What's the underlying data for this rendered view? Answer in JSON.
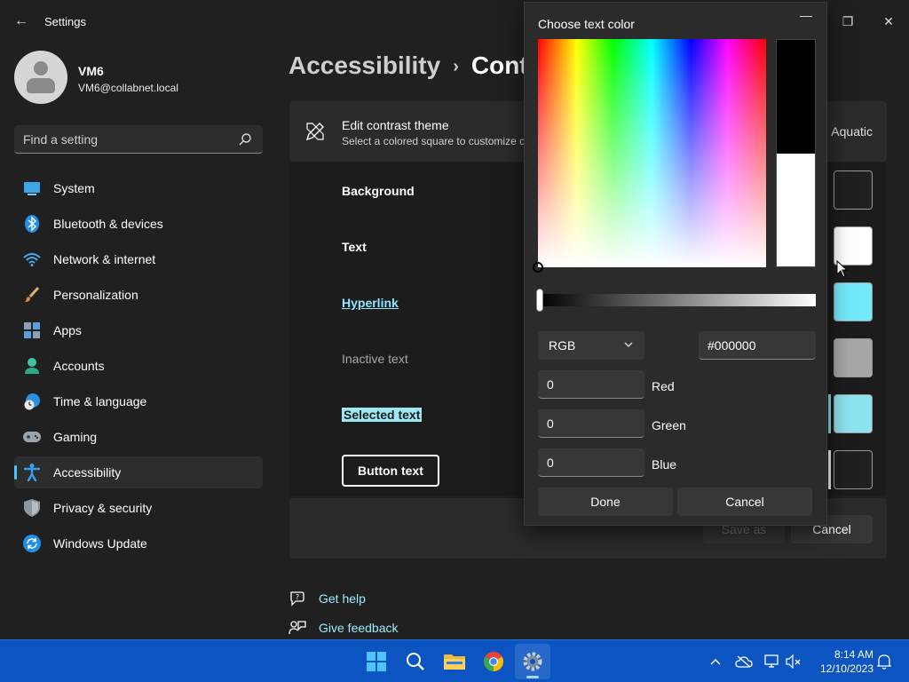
{
  "window": {
    "title": "Settings",
    "minimize_glyph": "—",
    "maximize_glyph": "❐",
    "close_glyph": "✕",
    "back_glyph": "←"
  },
  "profile": {
    "name": "VM6",
    "email": "VM6@collabnet.local"
  },
  "search": {
    "placeholder": "Find a setting"
  },
  "sidebar": {
    "items": [
      {
        "label": "System",
        "icon": "system-icon"
      },
      {
        "label": "Bluetooth & devices",
        "icon": "bluetooth-icon"
      },
      {
        "label": "Network & internet",
        "icon": "network-icon"
      },
      {
        "label": "Personalization",
        "icon": "brush-icon"
      },
      {
        "label": "Apps",
        "icon": "apps-icon"
      },
      {
        "label": "Accounts",
        "icon": "accounts-icon"
      },
      {
        "label": "Time & language",
        "icon": "clock-globe-icon"
      },
      {
        "label": "Gaming",
        "icon": "gamepad-icon"
      },
      {
        "label": "Accessibility",
        "icon": "accessibility-icon",
        "active": true
      },
      {
        "label": "Privacy & security",
        "icon": "shield-icon"
      },
      {
        "label": "Windows Update",
        "icon": "update-icon"
      }
    ]
  },
  "breadcrumb": {
    "parent": "Accessibility",
    "separator": "›",
    "current": "Contr"
  },
  "theme_card": {
    "title": "Edit contrast theme",
    "subtitle": "Select a colored square to customize c",
    "theme_name": "Aquatic"
  },
  "color_rows": [
    {
      "label": "Background",
      "swatch": "#202020"
    },
    {
      "label": "Text",
      "swatch": "#ffffff"
    },
    {
      "label": "Hyperlink",
      "swatch": "#75e9fc"
    },
    {
      "label": "Inactive text",
      "swatch": "#a6a6a6"
    },
    {
      "label": "Selected text",
      "swatch": "#8ee3f0"
    },
    {
      "label": "Button text",
      "swatch": "#202020"
    }
  ],
  "actions": {
    "save_as": "Save as",
    "cancel": "Cancel"
  },
  "help": {
    "get_help": "Get help",
    "give_feedback": "Give feedback"
  },
  "picker": {
    "title": "Choose text color",
    "new_color": "#000000",
    "old_color": "#ffffff",
    "mode": "RGB",
    "hex": "#000000",
    "red_value": "0",
    "red_label": "Red",
    "green_value": "0",
    "green_label": "Green",
    "blue_value": "0",
    "blue_label": "Blue",
    "done": "Done",
    "cancel": "Cancel"
  },
  "taskbar": {
    "apps": [
      "start-icon",
      "search-icon",
      "file-explorer-icon",
      "chrome-icon",
      "settings-icon"
    ],
    "time": "8:14 AM",
    "date": "12/10/2023"
  },
  "colors": {
    "accent": "#4cc2ff",
    "link": "#99ebff",
    "taskbar": "#0b54c2"
  }
}
